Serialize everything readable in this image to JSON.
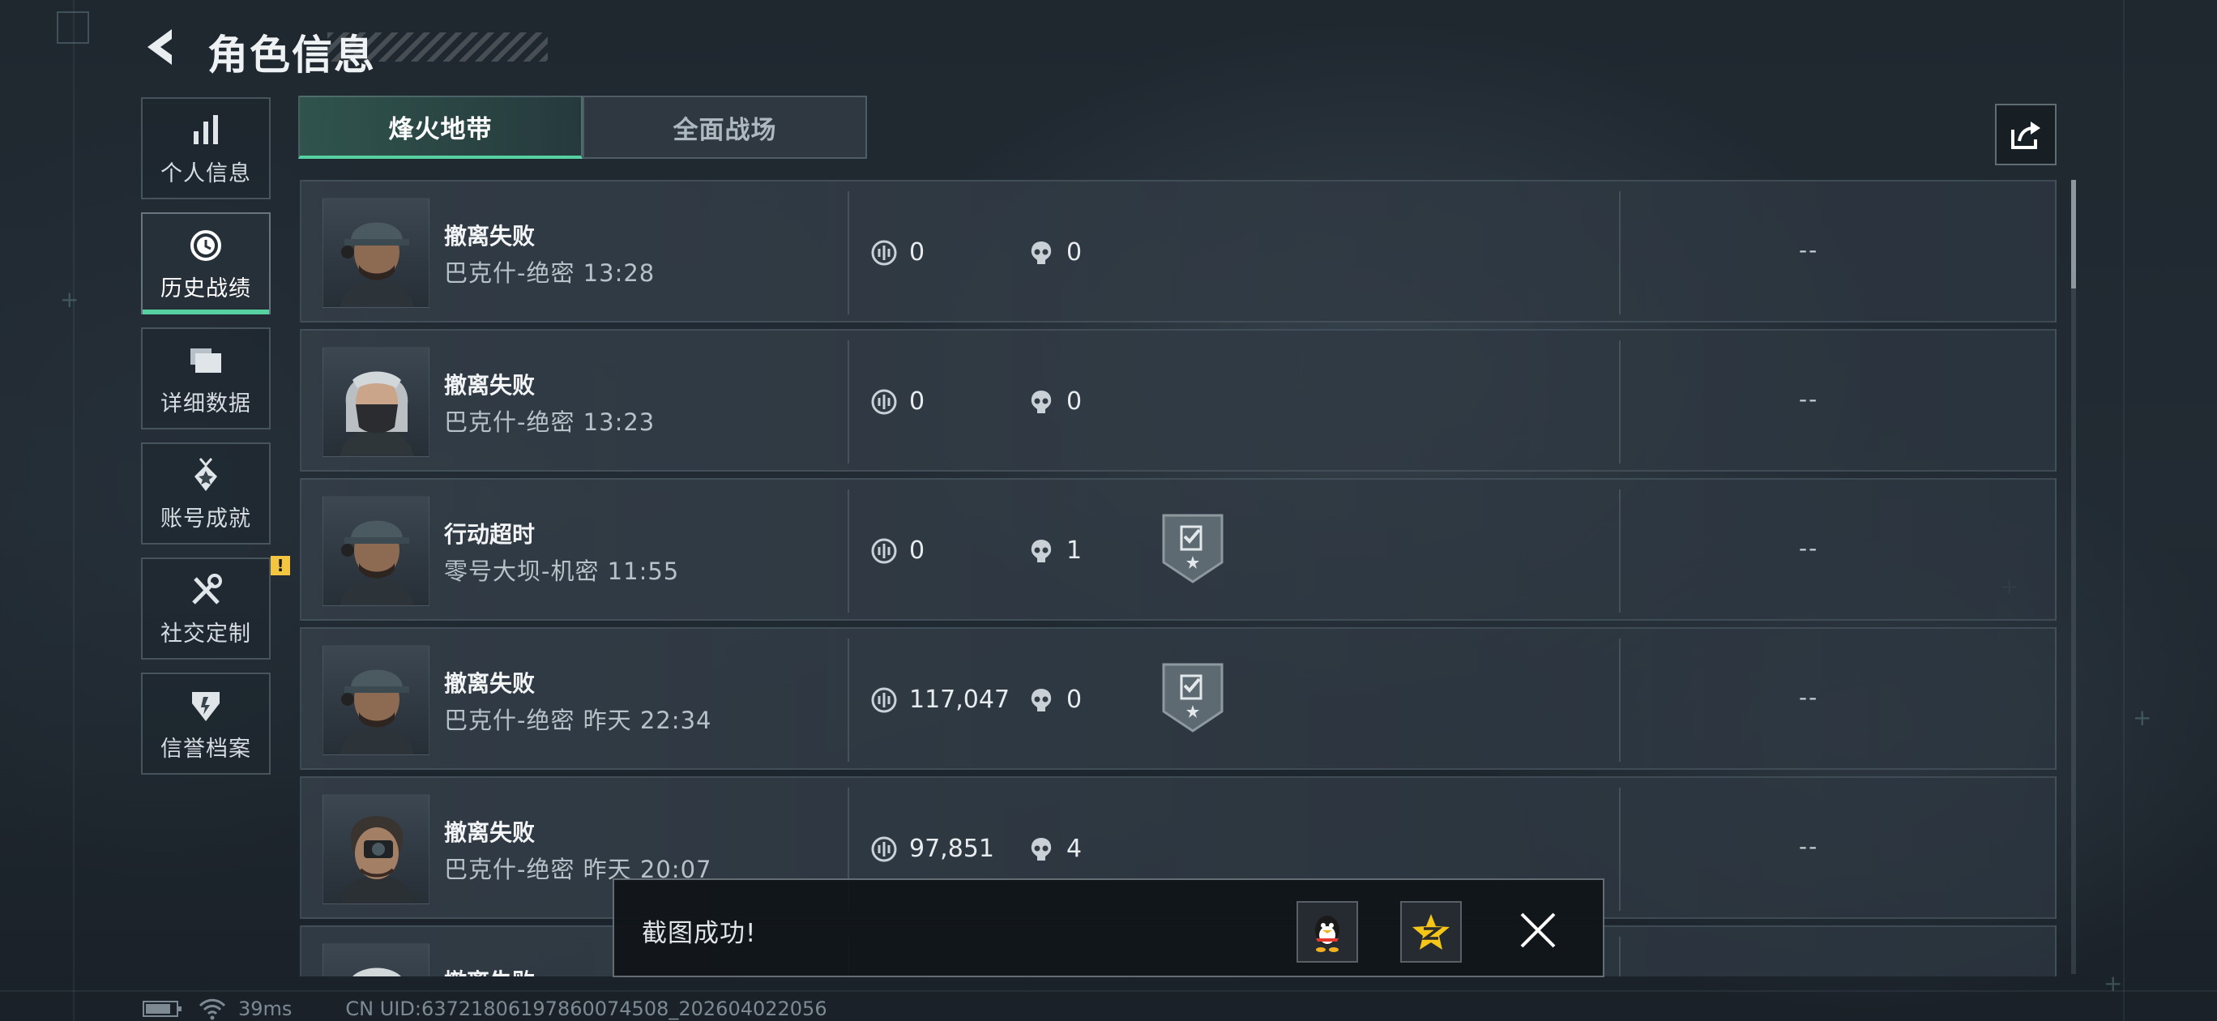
{
  "header": {
    "title": "角色信息"
  },
  "sidebar": {
    "items": [
      {
        "label": "个人信息",
        "icon": "bar-chart-icon"
      },
      {
        "label": "历史战绩",
        "icon": "history-clock-icon",
        "active": true
      },
      {
        "label": "详细数据",
        "icon": "folder-icon"
      },
      {
        "label": "账号成就",
        "icon": "medal-icon"
      },
      {
        "label": "社交定制",
        "icon": "tools-icon",
        "alert": "!"
      },
      {
        "label": "信誉档案",
        "icon": "shield-icon"
      }
    ]
  },
  "tabs": [
    {
      "label": "烽火地带",
      "active": true
    },
    {
      "label": "全面战场",
      "active": false
    }
  ],
  "matches": [
    {
      "status": "撤离失败",
      "map": "巴克什-绝密 13:28",
      "value": "0",
      "kills": "0",
      "badge": false,
      "extra": "--"
    },
    {
      "status": "撤离失败",
      "map": "巴克什-绝密 13:23",
      "value": "0",
      "kills": "0",
      "badge": false,
      "extra": "--"
    },
    {
      "status": "行动超时",
      "map": "零号大坝-机密 11:55",
      "value": "0",
      "kills": "1",
      "badge": true,
      "extra": "--"
    },
    {
      "status": "撤离失败",
      "map": "巴克什-绝密 昨天 22:34",
      "value": "117,047",
      "kills": "0",
      "badge": true,
      "extra": "--"
    },
    {
      "status": "撤离失败",
      "map": "巴克什-绝密 昨天 20:07",
      "value": "97,851",
      "kills": "4",
      "badge": false,
      "extra": "--"
    },
    {
      "status": "撤离失败",
      "map": "",
      "value": "",
      "kills": "",
      "badge": false,
      "extra": ""
    }
  ],
  "toast": {
    "text": "截图成功!"
  },
  "status_bar": {
    "ping": "39ms",
    "uid": "CN UID:63721806197860074508_202604022056"
  },
  "colors": {
    "accent": "#57d0a2",
    "alert": "#f4c541",
    "background": "#1f272f"
  }
}
